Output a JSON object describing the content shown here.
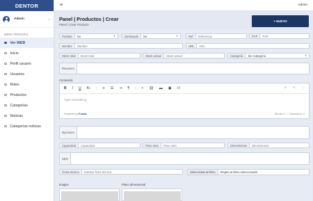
{
  "brand": "DENTOR",
  "user": {
    "name": "Admin"
  },
  "sidebar": {
    "section": "MENÚ PRINCIPAL",
    "items": [
      {
        "label": "Ver WEB",
        "active": true
      },
      {
        "label": "Inicio"
      },
      {
        "label": "Perfil usuario"
      },
      {
        "label": "Usuarios"
      },
      {
        "label": "Roles"
      },
      {
        "label": "Productos"
      },
      {
        "label": "Categorías"
      },
      {
        "label": "Noticias"
      },
      {
        "label": "Categorías noticias"
      }
    ]
  },
  "topbar": {
    "user": "Admin"
  },
  "page": {
    "title": "Panel | Productos | Crear",
    "breadcrumb": "Panel  /  Crear Producto",
    "new_button": "+ NUEVO"
  },
  "form": {
    "portada": {
      "label": "Portada",
      "value": "No"
    },
    "destacado": {
      "label": "Destacado",
      "value": "No"
    },
    "ref": {
      "label": "Ref",
      "placeholder": "Referencia"
    },
    "pvp": {
      "label": "PVP",
      "placeholder": "PVP"
    },
    "nombre": {
      "label": "Nombre",
      "placeholder": "Nombre"
    },
    "url": {
      "label": "URL",
      "placeholder": "URL"
    },
    "stock_total": {
      "label": "Stock total",
      "placeholder": "Stock total"
    },
    "stock_actual": {
      "label": "Stock actual",
      "placeholder": "Stock actual"
    },
    "categoria": {
      "label": "Categoría",
      "value": "Sin Categoría"
    },
    "resumen": {
      "label": "Resumen"
    },
    "contenido": {
      "label": "Contenido:"
    },
    "editor": {
      "placeholder": "Type something",
      "powered": "Powered by",
      "powered_brand": "Froala",
      "words_label": "Words",
      "words": "0",
      "chars_label": "Characters",
      "chars": "0"
    },
    "opciones": {
      "label": "Opciones"
    },
    "capacidad": {
      "label": "Capacidad",
      "placeholder": "Capacidad"
    },
    "peso_neto": {
      "label": "Peso neto",
      "placeholder": "Peso neto"
    },
    "dimensiones": {
      "label": "Dimensiones",
      "placeholder": "Dimensiones"
    },
    "seo": {
      "label": "SEO"
    },
    "ficha": {
      "label": "Ficha técnica",
      "placeholder": "Nombre ficha técnica"
    },
    "file": {
      "button": "Seleccionar archivo",
      "status": "Ningún archivo seleccionado"
    },
    "imagen": {
      "label": "Imagen"
    },
    "plano": {
      "label": "Plano dimensional"
    }
  },
  "toolbar": {
    "bold": "B",
    "italic": "I",
    "underline": "U",
    "font_size": "A↕",
    "align": "≡",
    "list": "☰",
    "indent": "⇥",
    "paragraph": "¶",
    "insert": "+",
    "link": "🔗",
    "folder": "▬",
    "image": "▣",
    "more": "⋮",
    "undo": "↶",
    "redo": "↷",
    "text": "+I"
  }
}
